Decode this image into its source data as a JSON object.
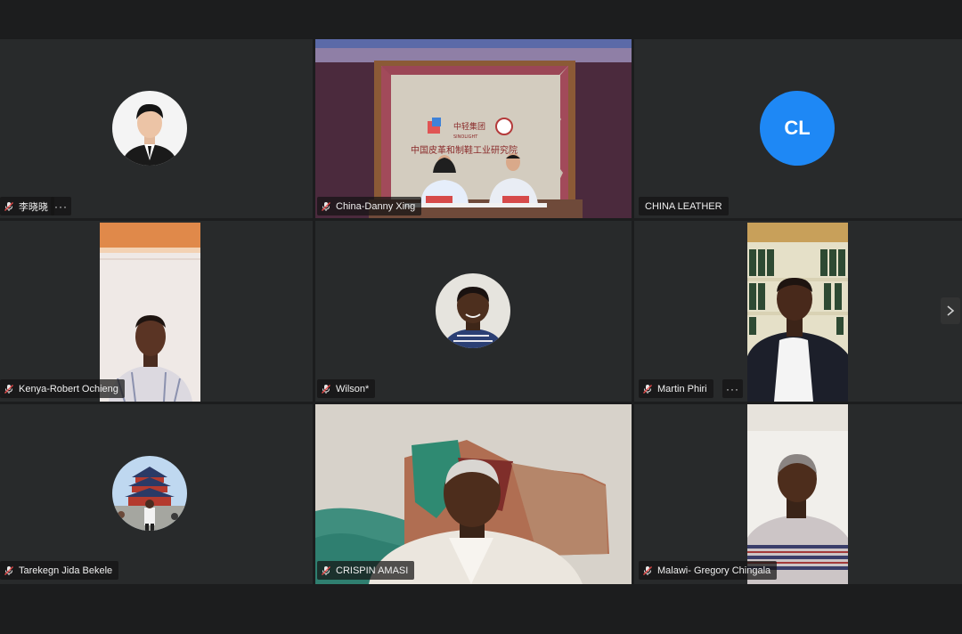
{
  "participants": [
    {
      "name": "李晓晓",
      "type": "photo-avatar",
      "has_more": true
    },
    {
      "name": "China-Danny Xing",
      "type": "video"
    },
    {
      "name": "CHINA LEATHER",
      "type": "initials",
      "initials": "CL",
      "color": "#1e88f5"
    },
    {
      "name": "Kenya-Robert Ochieng",
      "type": "video"
    },
    {
      "name": "Wilson*",
      "type": "photo-avatar"
    },
    {
      "name": "Martin Phiri",
      "type": "video",
      "has_more": true
    },
    {
      "name": "Tarekegn Jida Bekele",
      "type": "photo-avatar"
    },
    {
      "name": "CRISPIN AMASI",
      "type": "video"
    },
    {
      "name": "Malawi- Gregory Chingala",
      "type": "video"
    }
  ],
  "room_sign": {
    "brand_cn": "中轻集团",
    "brand_en": "SINOLIGHT",
    "institute": "中国皮革和制鞋工业研究院"
  },
  "controls": {
    "more_label": "···",
    "next_icon": "chevron-right-icon"
  },
  "colors": {
    "background": "#1c1d1e",
    "tile": "#282a2b",
    "initials_avatar": "#1e88f5"
  }
}
